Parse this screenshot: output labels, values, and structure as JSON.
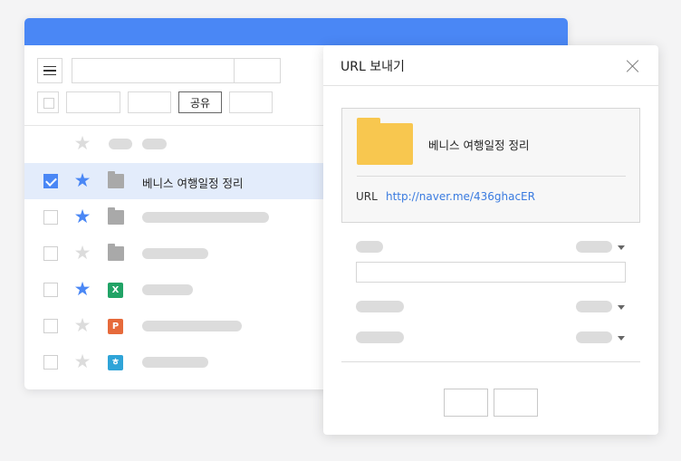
{
  "toolbar": {
    "share_label": "공유"
  },
  "file_list": [
    {
      "name": "",
      "starred": false,
      "checked": false,
      "icon": "none"
    },
    {
      "name": "베니스 여행일정 정리",
      "starred": true,
      "checked": true,
      "icon": "folder"
    },
    {
      "name": "",
      "starred": true,
      "checked": false,
      "icon": "folder"
    },
    {
      "name": "",
      "starred": false,
      "checked": false,
      "icon": "folder"
    },
    {
      "name": "",
      "starred": true,
      "checked": false,
      "icon": "excel-icon",
      "glyph": "X"
    },
    {
      "name": "",
      "starred": false,
      "checked": false,
      "icon": "powerpoint-icon",
      "glyph": "P"
    },
    {
      "name": "",
      "starred": false,
      "checked": false,
      "icon": "hwp-icon",
      "glyph": "ㅎ"
    }
  ],
  "dialog": {
    "title": "URL 보내기",
    "folder_name": "베니스 여행일정 정리",
    "url_label": "URL",
    "url": "http://naver.me/436ghacER"
  },
  "colors": {
    "accent": "#4a87f5",
    "folder": "#f8c74f",
    "link": "#3a7be0"
  }
}
